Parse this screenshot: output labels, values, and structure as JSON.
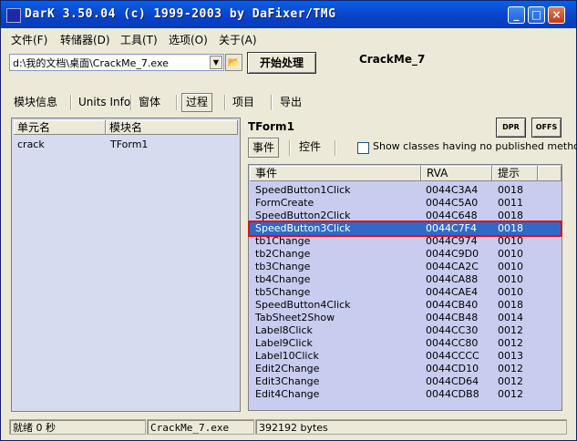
{
  "window": {
    "title": "DarK 3.50.04 (c) 1999-2003 by DaFixer/TMG",
    "minimize": "_",
    "maximize": "□",
    "close": "×"
  },
  "menu": [
    "文件(F)",
    "转储器(D)",
    "工具(T)",
    "选项(O)",
    "关于(A)"
  ],
  "toolbar": {
    "path_value": "d:\\我的文档\\桌面\\CrackMe_7.exe",
    "start_label": "开始处理",
    "file_label": "CrackMe_7"
  },
  "tabs": [
    "模块信息",
    "Units Info",
    "窗体",
    "过程",
    "项目",
    "导出"
  ],
  "active_tab": "过程",
  "left_panel": {
    "columns": [
      "单元名",
      "模块名"
    ],
    "rows": [
      {
        "unit": "crack",
        "module": "TForm1"
      }
    ]
  },
  "right_panel": {
    "form_name": "TForm1",
    "dpr_label": "DPR",
    "offs_label": "OFFS",
    "subtabs": [
      "事件",
      "控件"
    ],
    "checkbox_label": "Show classes having no published methods",
    "columns": [
      "事件",
      "RVA",
      "提示"
    ],
    "rows": [
      {
        "event": "SpeedButton1Click",
        "rva": "0044C3A4",
        "hint": "0018"
      },
      {
        "event": "FormCreate",
        "rva": "0044C5A0",
        "hint": "0011"
      },
      {
        "event": "SpeedButton2Click",
        "rva": "0044C648",
        "hint": "0018"
      },
      {
        "event": "SpeedButton3Click",
        "rva": "0044C7F4",
        "hint": "0018"
      },
      {
        "event": "tb1Change",
        "rva": "0044C974",
        "hint": "0010"
      },
      {
        "event": "tb2Change",
        "rva": "0044C9D0",
        "hint": "0010"
      },
      {
        "event": "tb3Change",
        "rva": "0044CA2C",
        "hint": "0010"
      },
      {
        "event": "tb4Change",
        "rva": "0044CA88",
        "hint": "0010"
      },
      {
        "event": "tb5Change",
        "rva": "0044CAE4",
        "hint": "0010"
      },
      {
        "event": "SpeedButton4Click",
        "rva": "0044CB40",
        "hint": "0018"
      },
      {
        "event": "TabSheet2Show",
        "rva": "0044CB48",
        "hint": "0014"
      },
      {
        "event": "Label8Click",
        "rva": "0044CC30",
        "hint": "0012"
      },
      {
        "event": "Label9Click",
        "rva": "0044CC80",
        "hint": "0012"
      },
      {
        "event": "Label10Click",
        "rva": "0044CCCC",
        "hint": "0013"
      },
      {
        "event": "Edit2Change",
        "rva": "0044CD10",
        "hint": "0012"
      },
      {
        "event": "Edit3Change",
        "rva": "0044CD64",
        "hint": "0012"
      },
      {
        "event": "Edit4Change",
        "rva": "0044CDB8",
        "hint": "0012"
      }
    ],
    "selected_row": 3
  },
  "status": {
    "ready": "就绪 0 秒",
    "file": "CrackMe_7.exe",
    "size": "392192 bytes"
  }
}
